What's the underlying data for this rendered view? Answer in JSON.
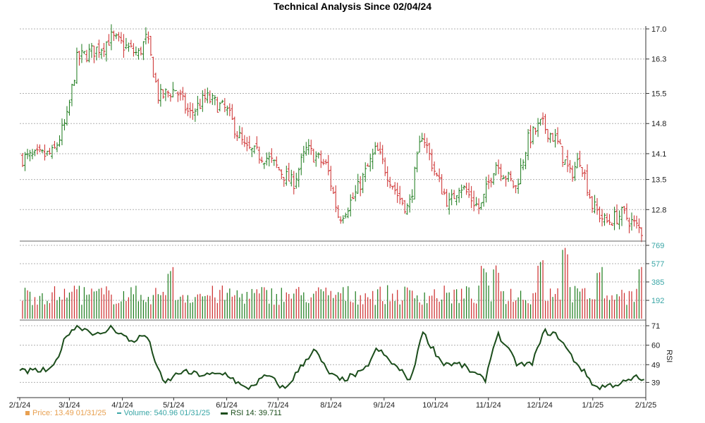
{
  "chart_data": {
    "type": "ohlc+bar+line",
    "title": "Technical Analysis Since 02/04/24",
    "x_tick_labels": [
      "2/1/24",
      "3/1/24",
      "4/1/24",
      "5/1/24",
      "6/1/24",
      "7/1/24",
      "8/1/24",
      "9/1/24",
      "10/1/24",
      "11/1/24",
      "12/1/24",
      "1/1/25",
      "2/1/25"
    ],
    "x_range": [
      "2024-02-01",
      "2025-02-01"
    ],
    "grid": true,
    "panels": {
      "price": {
        "y_ticks": [
          "12.8",
          "13.5",
          "14.1",
          "14.8",
          "15.5",
          "16.3",
          "17.0"
        ],
        "ylim": [
          12.1,
          17.0
        ],
        "bar_count": 252,
        "up_color": "#1a7a1a",
        "down_color": "#cc2a2a",
        "series": {
          "name": "Price",
          "closes": [
            {
              "date": "2024-02-05",
              "value": 14.0
            },
            {
              "date": "2024-02-20",
              "value": 14.1
            },
            {
              "date": "2024-02-28",
              "value": 14.9
            },
            {
              "date": "2024-03-05",
              "value": 16.3
            },
            {
              "date": "2024-03-20",
              "value": 16.6
            },
            {
              "date": "2024-03-25",
              "value": 16.8
            },
            {
              "date": "2024-04-10",
              "value": 16.4
            },
            {
              "date": "2024-04-15",
              "value": 16.8
            },
            {
              "date": "2024-04-22",
              "value": 15.4
            },
            {
              "date": "2024-05-02",
              "value": 15.6
            },
            {
              "date": "2024-05-10",
              "value": 15.0
            },
            {
              "date": "2024-05-20",
              "value": 15.4
            },
            {
              "date": "2024-06-01",
              "value": 15.1
            },
            {
              "date": "2024-06-12",
              "value": 14.2
            },
            {
              "date": "2024-06-25",
              "value": 14.0
            },
            {
              "date": "2024-07-10",
              "value": 13.4
            },
            {
              "date": "2024-07-18",
              "value": 14.2
            },
            {
              "date": "2024-07-30",
              "value": 13.8
            },
            {
              "date": "2024-08-06",
              "value": 12.6
            },
            {
              "date": "2024-08-15",
              "value": 13.1
            },
            {
              "date": "2024-08-28",
              "value": 14.2
            },
            {
              "date": "2024-09-10",
              "value": 13.1
            },
            {
              "date": "2024-09-16",
              "value": 12.8
            },
            {
              "date": "2024-09-24",
              "value": 14.6
            },
            {
              "date": "2024-10-02",
              "value": 13.6
            },
            {
              "date": "2024-10-10",
              "value": 12.9
            },
            {
              "date": "2024-10-16",
              "value": 13.4
            },
            {
              "date": "2024-10-28",
              "value": 12.8
            },
            {
              "date": "2024-11-06",
              "value": 13.9
            },
            {
              "date": "2024-11-18",
              "value": 13.3
            },
            {
              "date": "2024-11-25",
              "value": 14.4
            },
            {
              "date": "2024-12-03",
              "value": 14.8
            },
            {
              "date": "2024-12-12",
              "value": 14.4
            },
            {
              "date": "2024-12-20",
              "value": 13.6
            },
            {
              "date": "2024-12-26",
              "value": 14.0
            },
            {
              "date": "2025-01-02",
              "value": 12.9
            },
            {
              "date": "2025-01-10",
              "value": 12.5
            },
            {
              "date": "2025-01-20",
              "value": 12.7
            },
            {
              "date": "2025-01-31",
              "value": 12.3
            }
          ]
        }
      },
      "volume": {
        "y_ticks": [
          "192",
          "385",
          "577",
          "769"
        ],
        "ylim": [
          0,
          769
        ],
        "series": {
          "name": "Volume",
          "peaks": [
            {
              "date": "2024-03-05",
              "value": 360
            },
            {
              "date": "2024-04-29",
              "value": 550
            },
            {
              "date": "2024-10-30",
              "value": 560
            },
            {
              "date": "2024-11-07",
              "value": 560
            },
            {
              "date": "2024-12-02",
              "value": 640
            },
            {
              "date": "2024-12-17",
              "value": 769
            },
            {
              "date": "2025-01-06",
              "value": 550
            },
            {
              "date": "2025-01-31",
              "value": 560
            }
          ],
          "typical": 260
        }
      },
      "rsi": {
        "y_ticks": [
          "39",
          "49",
          "60",
          "71"
        ],
        "ylim": [
          32,
          71
        ],
        "label": "RSI",
        "color": "#1b4d1b",
        "series": {
          "name": "RSI 14",
          "values": [
            {
              "date": "2024-02-01",
              "value": 45
            },
            {
              "date": "2024-02-20",
              "value": 46
            },
            {
              "date": "2024-02-29",
              "value": 67
            },
            {
              "date": "2024-03-06",
              "value": 71
            },
            {
              "date": "2024-03-20",
              "value": 65
            },
            {
              "date": "2024-03-25",
              "value": 71
            },
            {
              "date": "2024-04-06",
              "value": 62
            },
            {
              "date": "2024-04-15",
              "value": 66
            },
            {
              "date": "2024-04-25",
              "value": 38
            },
            {
              "date": "2024-05-05",
              "value": 45
            },
            {
              "date": "2024-05-20",
              "value": 43
            },
            {
              "date": "2024-06-01",
              "value": 44
            },
            {
              "date": "2024-06-12",
              "value": 35
            },
            {
              "date": "2024-06-25",
              "value": 43
            },
            {
              "date": "2024-07-05",
              "value": 35
            },
            {
              "date": "2024-07-22",
              "value": 58
            },
            {
              "date": "2024-07-30",
              "value": 45
            },
            {
              "date": "2024-08-06",
              "value": 40
            },
            {
              "date": "2024-08-20",
              "value": 45
            },
            {
              "date": "2024-08-28",
              "value": 58
            },
            {
              "date": "2024-09-10",
              "value": 46
            },
            {
              "date": "2024-09-17",
              "value": 40
            },
            {
              "date": "2024-09-23",
              "value": 68
            },
            {
              "date": "2024-10-05",
              "value": 50
            },
            {
              "date": "2024-10-16",
              "value": 49
            },
            {
              "date": "2024-10-30",
              "value": 40
            },
            {
              "date": "2024-11-06",
              "value": 67
            },
            {
              "date": "2024-11-18",
              "value": 49
            },
            {
              "date": "2024-11-26",
              "value": 49
            },
            {
              "date": "2024-12-04",
              "value": 68
            },
            {
              "date": "2024-12-12",
              "value": 65
            },
            {
              "date": "2024-12-20",
              "value": 53
            },
            {
              "date": "2024-12-26",
              "value": 46
            },
            {
              "date": "2025-01-03",
              "value": 36
            },
            {
              "date": "2025-01-20",
              "value": 39
            },
            {
              "date": "2025-01-27",
              "value": 42
            },
            {
              "date": "2025-01-31",
              "value": 39.7
            }
          ]
        }
      }
    }
  },
  "legend": {
    "price": {
      "label": "Price: 13.49  01/31/25",
      "color": "#e8a050"
    },
    "volume": {
      "label": "Volume: 540.96  01/31/25",
      "color": "#3aa6a6"
    },
    "rsi": {
      "label": "RSI 14: 39.711",
      "color": "#1b4d1b"
    }
  }
}
